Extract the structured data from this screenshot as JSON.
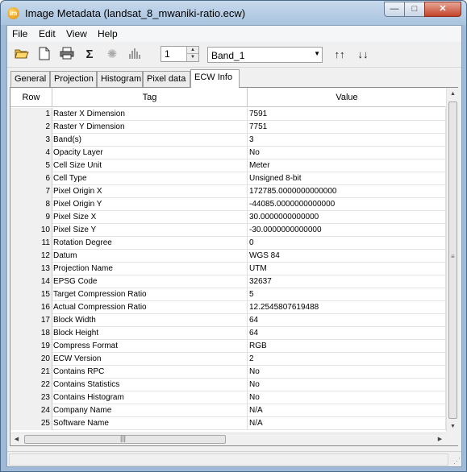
{
  "window": {
    "title": "Image Metadata (landsat_8_mwaniki-ratio.ecw)",
    "app_icon_text": "im",
    "buttons": {
      "minimize": "—",
      "maximize": "□",
      "close": "✕"
    }
  },
  "menu": [
    "File",
    "Edit",
    "View",
    "Help"
  ],
  "toolbar": {
    "icons": [
      "open-folder-icon",
      "new-document-icon",
      "print-icon",
      "sigma-icon",
      "gear-icon",
      "histogram-icon"
    ],
    "spinner_value": "1",
    "band_select_value": "Band_1",
    "sort_ascending": "↑↑",
    "sort_descending": "↓↓"
  },
  "tabs": [
    "General",
    "Projection",
    "Histogram",
    "Pixel data",
    "ECW Info"
  ],
  "active_tab": "ECW Info",
  "grid": {
    "headers": {
      "row": "Row",
      "tag": "Tag",
      "value": "Value"
    },
    "rows": [
      {
        "row": "1",
        "tag": "Raster X Dimension",
        "value": "7591"
      },
      {
        "row": "2",
        "tag": "Raster Y Dimension",
        "value": "7751"
      },
      {
        "row": "3",
        "tag": "Band(s)",
        "value": "3"
      },
      {
        "row": "4",
        "tag": "Opacity Layer",
        "value": "No"
      },
      {
        "row": "5",
        "tag": "Cell Size Unit",
        "value": "Meter"
      },
      {
        "row": "6",
        "tag": "Cell Type",
        "value": "Unsigned 8-bit"
      },
      {
        "row": "7",
        "tag": "Pixel Origin X",
        "value": "172785.0000000000000"
      },
      {
        "row": "8",
        "tag": "Pixel Origin Y",
        "value": "-44085.0000000000000"
      },
      {
        "row": "9",
        "tag": "Pixel Size X",
        "value": "30.0000000000000"
      },
      {
        "row": "10",
        "tag": "Pixel Size Y",
        "value": "-30.0000000000000"
      },
      {
        "row": "11",
        "tag": "Rotation Degree",
        "value": "0"
      },
      {
        "row": "12",
        "tag": "Datum",
        "value": "WGS 84"
      },
      {
        "row": "13",
        "tag": "Projection Name",
        "value": "UTM"
      },
      {
        "row": "14",
        "tag": "EPSG Code",
        "value": "32637"
      },
      {
        "row": "15",
        "tag": "Target Compression Ratio",
        "value": "5"
      },
      {
        "row": "16",
        "tag": "Actual Compression Ratio",
        "value": "12.2545807619488"
      },
      {
        "row": "17",
        "tag": "Block Width",
        "value": "64"
      },
      {
        "row": "18",
        "tag": "Block Height",
        "value": "64"
      },
      {
        "row": "19",
        "tag": "Compress Format",
        "value": "RGB"
      },
      {
        "row": "20",
        "tag": "ECW Version",
        "value": "2"
      },
      {
        "row": "21",
        "tag": "Contains RPC",
        "value": "No"
      },
      {
        "row": "22",
        "tag": "Contains Statistics",
        "value": "No"
      },
      {
        "row": "23",
        "tag": "Contains Histogram",
        "value": "No"
      },
      {
        "row": "24",
        "tag": "Company Name",
        "value": "N/A"
      },
      {
        "row": "25",
        "tag": "Software Name",
        "value": "N/A"
      }
    ]
  },
  "scrollbars": {
    "up": "▲",
    "down": "▼",
    "left": "◀",
    "right": "▶",
    "grip_v": "≡",
    "grip_h": "|||"
  }
}
